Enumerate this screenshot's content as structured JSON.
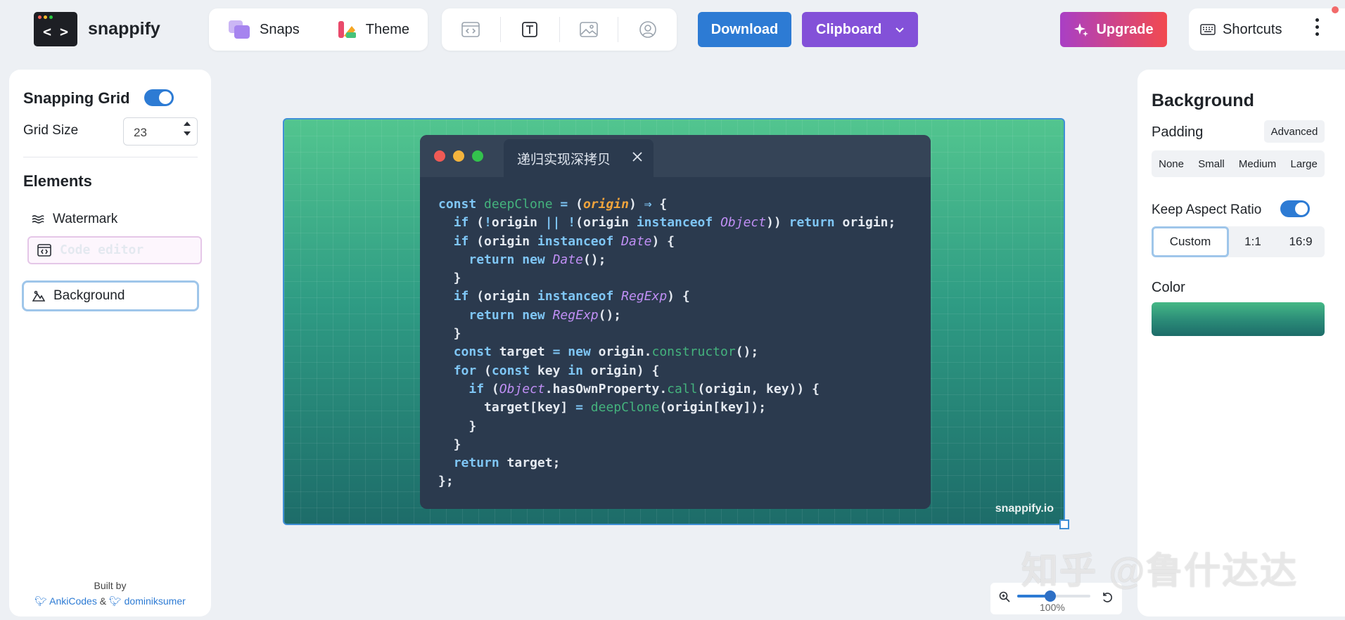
{
  "app": {
    "name": "snappify"
  },
  "nav": {
    "snaps": "Snaps",
    "theme": "Theme"
  },
  "actions": {
    "download": "Download",
    "clipboard": "Clipboard",
    "upgrade": "Upgrade",
    "shortcuts": "Shortcuts"
  },
  "left_panel": {
    "snapping_grid": "Snapping Grid",
    "grid_size_label": "Grid Size",
    "grid_size_value": "23",
    "elements_title": "Elements",
    "elements": [
      {
        "label": "Watermark",
        "icon": "waves-icon"
      },
      {
        "label": "Code editor",
        "icon": "code-window-icon"
      },
      {
        "label": "Background",
        "icon": "mountain-icon"
      }
    ],
    "built_by": "Built by",
    "author1": "AnkiCodes",
    "amp": "&",
    "author2": "dominiksumer"
  },
  "canvas": {
    "file_name": "递归实现深拷贝",
    "watermark": "snappify.io",
    "zoom": "100%",
    "zoom_level": 0.45
  },
  "right_panel": {
    "title": "Background",
    "padding_label": "Padding",
    "advanced": "Advanced",
    "padding_options": [
      "None",
      "Small",
      "Medium",
      "Large"
    ],
    "aspect_label": "Keep Aspect Ratio",
    "aspect_options": [
      "Custom",
      "1:1",
      "16:9"
    ],
    "color_label": "Color"
  },
  "overlay_text": "知乎 @鲁什达达",
  "colors": {
    "accent": "#2d7bd4",
    "clipboard": "#8351d8",
    "bg_top": "#52c58f",
    "bg_bottom": "#1d6c69",
    "editor": "#2b3a4e"
  }
}
